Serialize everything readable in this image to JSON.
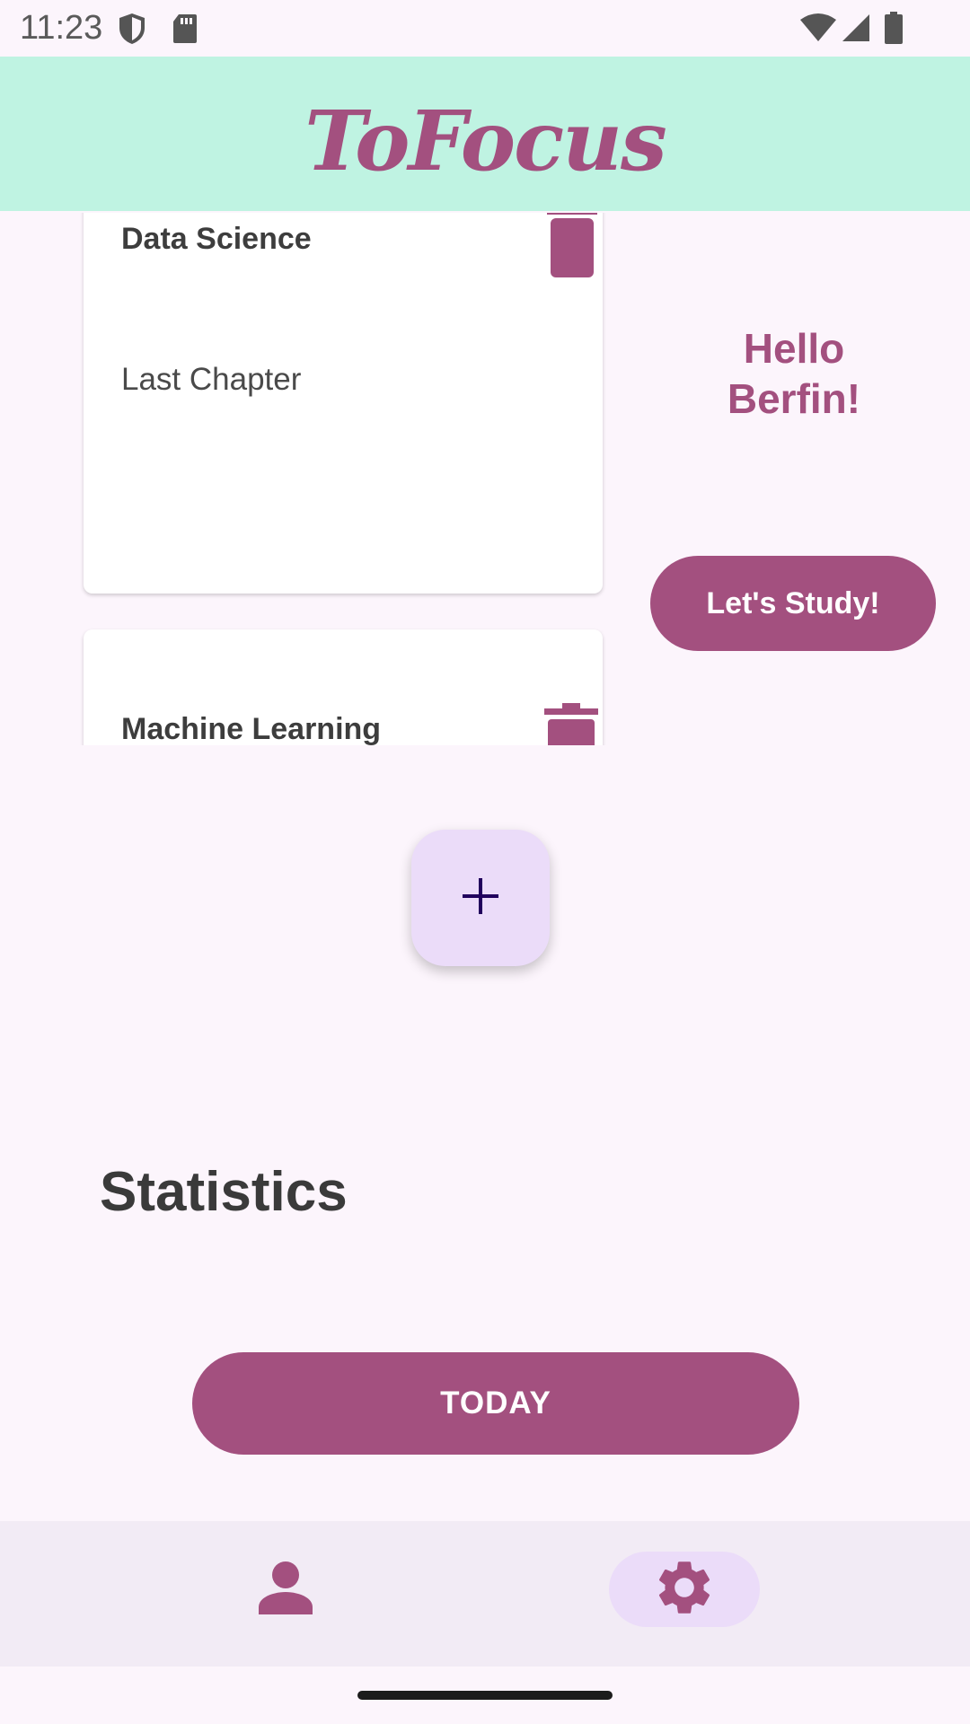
{
  "status_bar": {
    "time": "11:23",
    "icons": [
      "shield-icon",
      "sd-card-icon",
      "wifi-icon",
      "signal-icon",
      "battery-icon"
    ]
  },
  "app": {
    "title": "ToFocus",
    "colors": {
      "primary": "#a3507f",
      "app_bar": "#bff3e2",
      "background": "#fcf5fc",
      "fab": "#ebdcf9"
    }
  },
  "tasks": [
    {
      "title": "Data Science",
      "description": "Last Chapter",
      "delete_icon": "trash-icon"
    },
    {
      "title": "Machine Learning",
      "description": "",
      "delete_icon": "trash-icon"
    }
  ],
  "greeting": {
    "line1": "Hello",
    "line2": "Berfin!"
  },
  "study_button": {
    "label": "Let's Study!"
  },
  "fab": {
    "icon": "plus-icon"
  },
  "statistics": {
    "title": "Statistics",
    "today_button": "TODAY"
  },
  "bottom_nav": {
    "items": [
      {
        "icon": "person-icon",
        "active": false
      },
      {
        "icon": "gear-icon",
        "active": true
      }
    ]
  }
}
